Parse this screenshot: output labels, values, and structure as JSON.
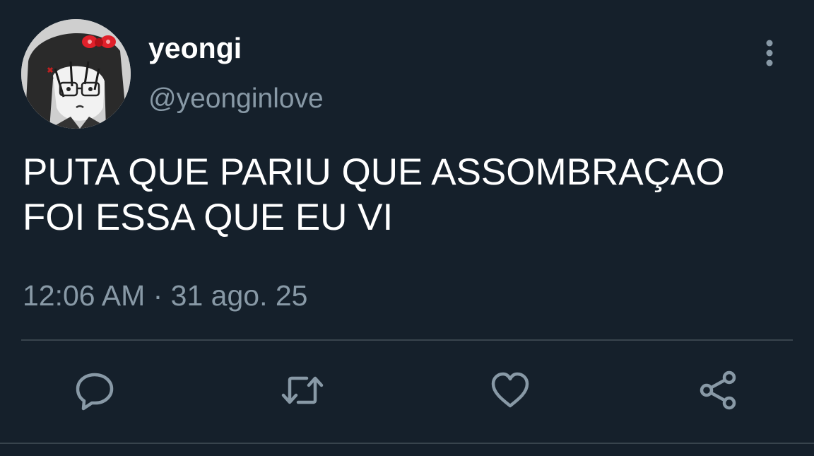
{
  "user": {
    "display_name": "yeongi",
    "handle": "@yeonginlove",
    "avatar_icon": "avatar-manga-girl-with-red-bow"
  },
  "tweet": {
    "text": "PUTA QUE PARIU QUE ASSOMBRAÇAO\nFOI ESSA QUE EU VI",
    "timestamp": "12:06 AM · 31 ago. 25"
  },
  "actions": {
    "reply_icon": "speech-bubble-icon",
    "retweet_icon": "retweet-arrows-icon",
    "like_icon": "heart-icon",
    "share_icon": "share-nodes-icon",
    "more_icon": "vertical-dots-icon"
  },
  "colors": {
    "background": "#15202b",
    "primary_text": "#ffffff",
    "secondary_text": "#8899a6",
    "divider": "#38444d",
    "icon": "#8899a6",
    "bow": "#e0202a"
  }
}
